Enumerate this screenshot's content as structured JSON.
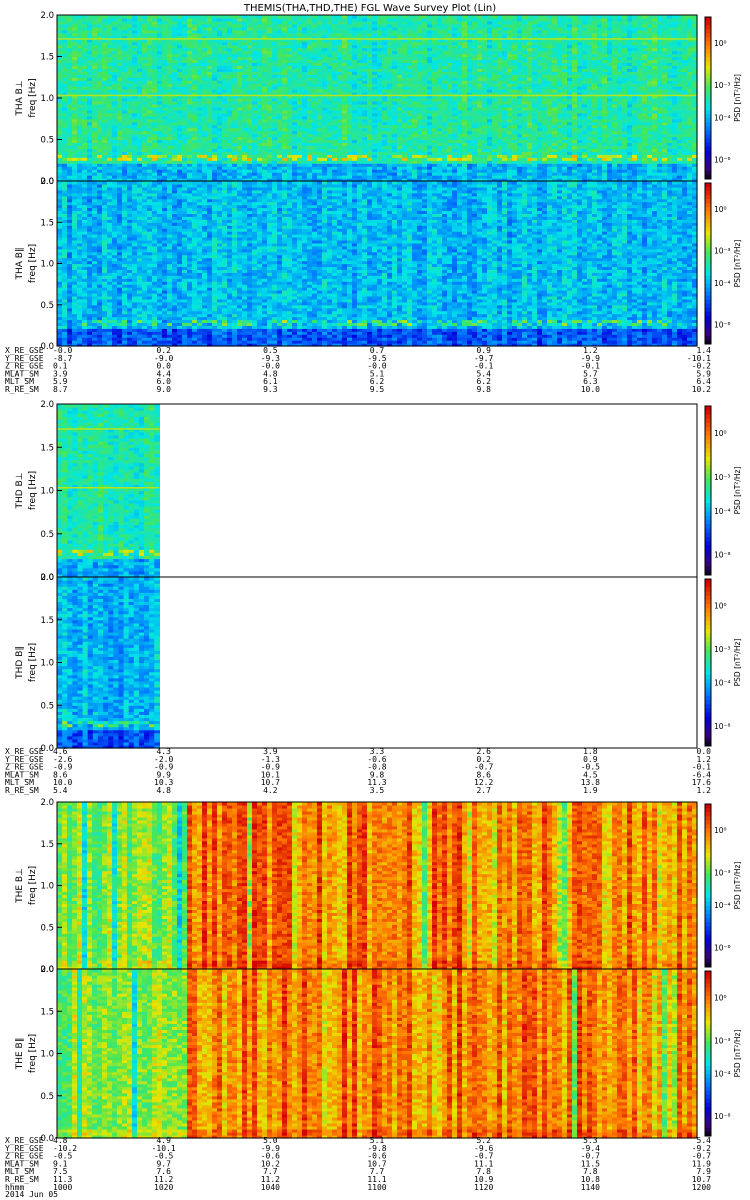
{
  "chart_data": {
    "type": "heatmap",
    "title": "THEMIS(THA,THD,THE) FGL Wave Survey Plot (Lin)",
    "colorbar_label": "PSD [nT²/Hz]",
    "colorbar_ticks": [
      "10⁰",
      "10⁻³",
      "10⁻⁴",
      "10⁻⁶"
    ],
    "colorbar_ticks_alt": [
      "10⁰",
      "10⁻³",
      "10⁻⁴",
      "10⁻⁸"
    ],
    "y_ticks": [
      "0.0",
      "0.5",
      "1.0",
      "1.5",
      "2.0"
    ],
    "ylim": [
      0,
      2
    ],
    "y_label": "freq [Hz]",
    "panels": [
      {
        "probe": "THA",
        "component": "B⊥",
        "title": "THA B⊥",
        "group": 0,
        "colormap_bias": "low",
        "data_fraction": 1.0,
        "cb_ticks_variant": "main"
      },
      {
        "probe": "THA",
        "component": "B∥",
        "title": "THA B∥",
        "group": 0,
        "colormap_bias": "lower",
        "data_fraction": 1.0,
        "cb_ticks_variant": "main"
      },
      {
        "probe": "THD",
        "component": "B⊥",
        "title": "THD B⊥",
        "group": 1,
        "colormap_bias": "low",
        "data_fraction": 0.16,
        "cb_ticks_variant": "alt"
      },
      {
        "probe": "THD",
        "component": "B∥",
        "title": "THD B∥",
        "group": 1,
        "colormap_bias": "lower",
        "data_fraction": 0.16,
        "cb_ticks_variant": "alt"
      },
      {
        "probe": "THE",
        "component": "B⊥",
        "title": "THE B⊥",
        "group": 2,
        "colormap_bias": "high",
        "data_fraction": 1.0,
        "cb_ticks_variant": "main"
      },
      {
        "probe": "THE",
        "component": "B∥",
        "title": "THE B∥",
        "group": 2,
        "colormap_bias": "high",
        "data_fraction": 1.0,
        "cb_ticks_variant": "alt"
      }
    ],
    "ephemeris": [
      {
        "probe": "THA",
        "rows": [
          {
            "label": "X_RE_GSE",
            "values": [
              "-0.0",
              "0.2",
              "0.5",
              "0.7",
              "0.9",
              "1.2",
              "1.4"
            ]
          },
          {
            "label": "Y_RE_GSE",
            "values": [
              "-8.7",
              "-9.0",
              "-9.3",
              "-9.5",
              "-9.7",
              "-9.9",
              "-10.1"
            ]
          },
          {
            "label": "Z_RE_GSE",
            "values": [
              "0.1",
              "0.0",
              "-0.0",
              "-0.0",
              "-0.1",
              "-0.1",
              "-0.2"
            ]
          },
          {
            "label": "MLAT_SM",
            "values": [
              "3.9",
              "4.4",
              "4.8",
              "5.1",
              "5.4",
              "5.7",
              "5.9"
            ]
          },
          {
            "label": "MLT_SM",
            "values": [
              "5.9",
              "6.0",
              "6.1",
              "6.2",
              "6.2",
              "6.3",
              "6.4"
            ]
          },
          {
            "label": "R_RE_SM",
            "values": [
              "8.7",
              "9.0",
              "9.3",
              "9.5",
              "9.8",
              "10.0",
              "10.2"
            ]
          }
        ]
      },
      {
        "probe": "THD",
        "rows": [
          {
            "label": "X_RE_GSE",
            "values": [
              "4.6",
              "4.3",
              "3.9",
              "3.3",
              "2.6",
              "1.8",
              "0.0"
            ]
          },
          {
            "label": "Y_RE_GSE",
            "values": [
              "-2.6",
              "-2.0",
              "-1.3",
              "-0.6",
              "0.2",
              "0.9",
              "1.2"
            ]
          },
          {
            "label": "Z_RE_GSE",
            "values": [
              "-0.9",
              "-0.9",
              "-0.9",
              "-0.8",
              "-0.7",
              "-0.5",
              "-0.1"
            ]
          },
          {
            "label": "MLAT_SM",
            "values": [
              "8.6",
              "9.9",
              "10.1",
              "9.8",
              "8.6",
              "4.5",
              "-6.4"
            ]
          },
          {
            "label": "MLT_SM",
            "values": [
              "10.0",
              "10.3",
              "10.7",
              "11.3",
              "12.2",
              "13.8",
              "17.6"
            ]
          },
          {
            "label": "R_RE_SM",
            "values": [
              "5.4",
              "4.8",
              "4.2",
              "3.5",
              "2.7",
              "1.9",
              "1.2"
            ]
          }
        ]
      },
      {
        "probe": "THE",
        "rows": [
          {
            "label": "X_RE_GSE",
            "values": [
              "4.8",
              "4.9",
              "5.0",
              "5.1",
              "5.2",
              "5.3",
              "5.4"
            ]
          },
          {
            "label": "Y_RE_GSE",
            "values": [
              "-10.2",
              "-10.1",
              "-9.9",
              "-9.8",
              "-9.6",
              "-9.4",
              "-9.2"
            ]
          },
          {
            "label": "Z_RE_GSE",
            "values": [
              "-0.5",
              "-0.5",
              "-0.6",
              "-0.6",
              "-0.7",
              "-0.7",
              "-0.7"
            ]
          },
          {
            "label": "MLAT_SM",
            "values": [
              "9.1",
              "9.7",
              "10.2",
              "10.7",
              "11.1",
              "11.5",
              "11.9"
            ]
          },
          {
            "label": "MLT_SM",
            "values": [
              "7.5",
              "7.6",
              "7.7",
              "7.7",
              "7.8",
              "7.8",
              "7.9"
            ]
          },
          {
            "label": "R_RE_SM",
            "values": [
              "11.3",
              "11.2",
              "11.2",
              "11.1",
              "10.9",
              "10.8",
              "10.7"
            ]
          },
          {
            "label": "hhmm",
            "values": [
              "1000",
              "1020",
              "1040",
              "1100",
              "1120",
              "1140",
              "1200"
            ]
          }
        ]
      }
    ],
    "date_label": "2014 Jun 05",
    "time_ticks": [
      "1000",
      "1020",
      "1040",
      "1100",
      "1120",
      "1140",
      "1200"
    ]
  },
  "colors": {
    "frame": "#000000",
    "background": "#ffffff"
  }
}
